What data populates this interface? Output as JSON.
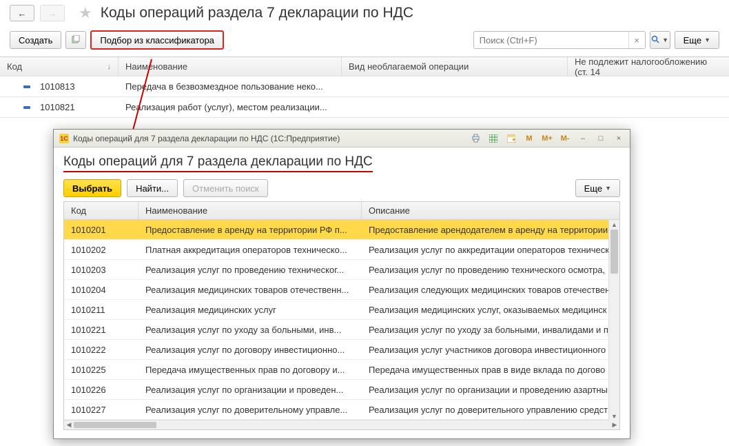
{
  "nav": {
    "back": "←",
    "forward": "→"
  },
  "page_title": "Коды операций раздела 7 декларации по НДС",
  "toolbar": {
    "create": "Создать",
    "pick_from_classifier": "Подбор из классификатора",
    "search_placeholder": "Поиск (Ctrl+F)",
    "search_clear": "×",
    "more": "Еще"
  },
  "main_table": {
    "cols": {
      "code": "Код",
      "name": "Наименование",
      "kind": "Вид необлагаемой операции",
      "notax": "Не подлежит налогообложению (ст. 14"
    },
    "rows": [
      {
        "code": "1010813",
        "name": "Передача в безвозмездное пользование неко..."
      },
      {
        "code": "1010821",
        "name": "Реализация работ (услуг), местом реализации..."
      }
    ]
  },
  "dialog": {
    "titlebar": "Коды операций для 7 раздела декларации по НДС  (1С:Предприятие)",
    "logo_text": "1C",
    "heading": "Коды операций для 7 раздела декларации по НДС",
    "toolbar": {
      "select": "Выбрать",
      "find": "Найти...",
      "cancel_find": "Отменить поиск",
      "more": "Еще"
    },
    "cols": {
      "code": "Код",
      "name": "Наименование",
      "desc": "Описание"
    },
    "rows": [
      {
        "code": "1010201",
        "name": "Предоставление в аренду на территории РФ п...",
        "desc": "Предоставление арендодателем в аренду на территории",
        "selected": true
      },
      {
        "code": "1010202",
        "name": "Платная аккредитация операторов техническо...",
        "desc": "Реализация услуг по аккредитации операторов техническ"
      },
      {
        "code": "1010203",
        "name": "Реализация услуг по проведению техническог...",
        "desc": "Реализация услуг по проведению технического осмотра,"
      },
      {
        "code": "1010204",
        "name": "Реализация медицинских товаров отечественн...",
        "desc": "Реализация следующих медицинских товаров отечествен"
      },
      {
        "code": "1010211",
        "name": "Реализация медицинских услуг",
        "desc": "Реализация медицинских услуг, оказываемых медицинск"
      },
      {
        "code": "1010221",
        "name": "Реализация услуг по уходу за больными, инв...",
        "desc": "Реализация услуг по уходу за больными, инвалидами и п"
      },
      {
        "code": "1010222",
        "name": "Реализация услуг по договору инвестиционно...",
        "desc": "Реализация услуг участников договора инвестиционного"
      },
      {
        "code": "1010225",
        "name": "Передача имущественных прав по договору и...",
        "desc": "Передача имущественных прав в виде вклада по догово"
      },
      {
        "code": "1010226",
        "name": "Реализация услуг по организации и проведен...",
        "desc": "Реализация услуг по организации и проведению азартны"
      },
      {
        "code": "1010227",
        "name": "Реализация услуг по доверительному управле...",
        "desc": "Реализация услуг по доверительного управлению средст"
      }
    ],
    "title_icons": {
      "print": "print-icon",
      "table": "table-icon",
      "calendar": "calendar-icon",
      "m": "M",
      "mplus": "M+",
      "mminus": "M-",
      "min": "–",
      "max": "□",
      "close": "×"
    }
  }
}
